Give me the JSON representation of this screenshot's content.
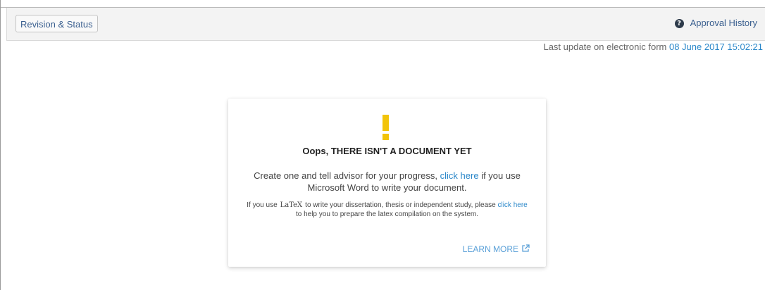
{
  "toolbar": {
    "revision_status_label": "Revision & Status",
    "approval_history_label": "Approval History",
    "help_icon": "question-circle-icon"
  },
  "last_update": {
    "prefix": "Last update on electronic form",
    "date": "08 June 2017 15:02:21"
  },
  "empty_state": {
    "icon": "exclamation-icon",
    "icon_color": "#f2c40a",
    "title": "Oops, THERE ISN'T A DOCUMENT YET",
    "message_before": "Create one and tell advisor for your progress,",
    "message_link": "click here",
    "message_after": "if you use Microsoft Word to write your document.",
    "note_before": "If you use",
    "note_latex": "LaTeX",
    "note_middle": "to write your dissertation, thesis or independent study, please",
    "note_link": "click here",
    "note_after": "to help you to prepare the latex compilation on the system.",
    "learn_more_label": "LEARN MORE",
    "learn_more_icon": "external-link-icon"
  },
  "colors": {
    "link": "#2a87c9",
    "toolbar_bg": "#f3f3f3",
    "accent_warning": "#f2c40a"
  }
}
